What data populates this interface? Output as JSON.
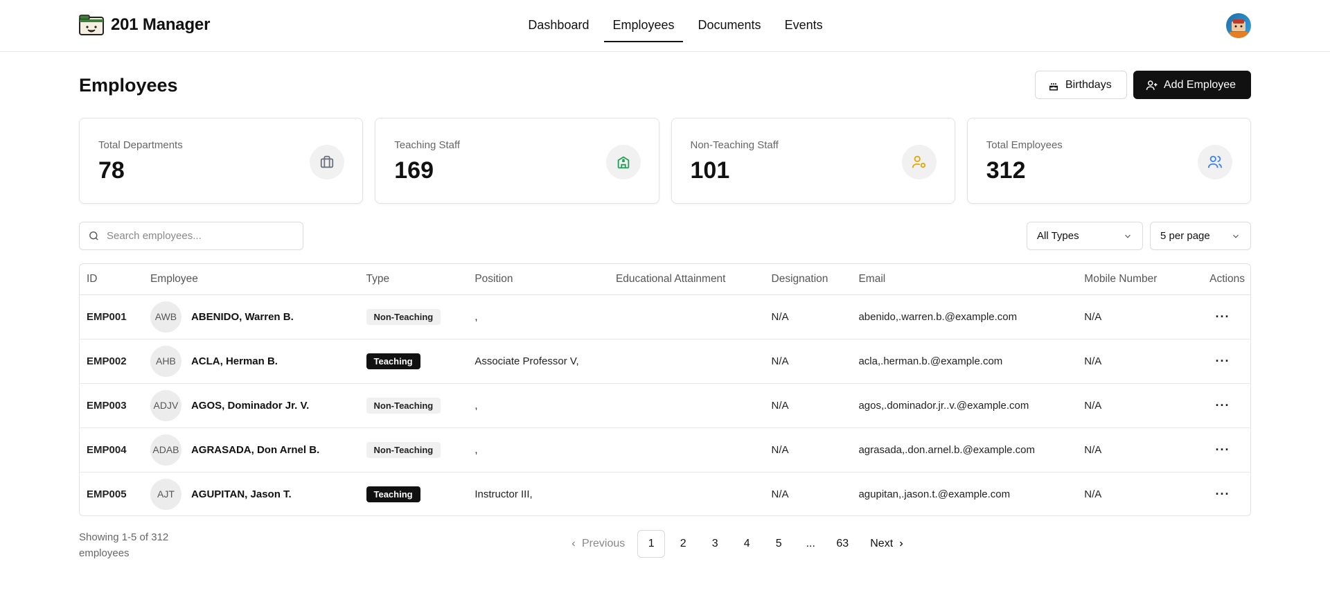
{
  "app": {
    "name": "201 Manager",
    "nav": [
      {
        "label": "Dashboard",
        "active": false
      },
      {
        "label": "Employees",
        "active": true
      },
      {
        "label": "Documents",
        "active": false
      },
      {
        "label": "Events",
        "active": false
      }
    ]
  },
  "header": {
    "title": "Employees",
    "birthdays_label": "Birthdays",
    "add_employee_label": "Add Employee"
  },
  "stats": [
    {
      "label": "Total Departments",
      "value": "78",
      "icon": "briefcase-icon",
      "color": "#6b7280"
    },
    {
      "label": "Teaching Staff",
      "value": "169",
      "icon": "school-icon",
      "color": "#22a05a"
    },
    {
      "label": "Non-Teaching Staff",
      "value": "101",
      "icon": "user-cog-icon",
      "color": "#e0a800"
    },
    {
      "label": "Total Employees",
      "value": "312",
      "icon": "users-icon",
      "color": "#3b82f6"
    }
  ],
  "filters": {
    "search_placeholder": "Search employees...",
    "type_selected": "All Types",
    "per_page_selected": "5 per page"
  },
  "table": {
    "columns": [
      "ID",
      "Employee",
      "Type",
      "Position",
      "Educational Attainment",
      "Designation",
      "Email",
      "Mobile Number",
      "Actions"
    ],
    "rows": [
      {
        "id": "EMP001",
        "initials": "AWB",
        "name": "ABENIDO, Warren B.",
        "type": "Non-Teaching",
        "position": ",",
        "education": "",
        "designation": "N/A",
        "email": "abenido,.warren.b.@example.com",
        "mobile": "N/A"
      },
      {
        "id": "EMP002",
        "initials": "AHB",
        "name": "ACLA, Herman B.",
        "type": "Teaching",
        "position": "Associate Professor V,",
        "education": "",
        "designation": "N/A",
        "email": "acla,.herman.b.@example.com",
        "mobile": "N/A"
      },
      {
        "id": "EMP003",
        "initials": "ADJV",
        "name": "AGOS, Dominador Jr. V.",
        "type": "Non-Teaching",
        "position": ",",
        "education": "",
        "designation": "N/A",
        "email": "agos,.dominador.jr..v.@example.com",
        "mobile": "N/A"
      },
      {
        "id": "EMP004",
        "initials": "ADAB",
        "name": "AGRASADA, Don Arnel B.",
        "type": "Non-Teaching",
        "position": ",",
        "education": "",
        "designation": "N/A",
        "email": "agrasada,.don.arnel.b.@example.com",
        "mobile": "N/A"
      },
      {
        "id": "EMP005",
        "initials": "AJT",
        "name": "AGUPITAN, Jason T.",
        "type": "Teaching",
        "position": "Instructor III,",
        "education": "",
        "designation": "N/A",
        "email": "agupitan,.jason.t.@example.com",
        "mobile": "N/A"
      }
    ]
  },
  "footer": {
    "showing_text": "Showing 1-5 of 312 employees",
    "previous_label": "Previous",
    "next_label": "Next",
    "pages": [
      "1",
      "2",
      "3",
      "4",
      "5",
      "...",
      "63"
    ],
    "current_page": "1"
  }
}
